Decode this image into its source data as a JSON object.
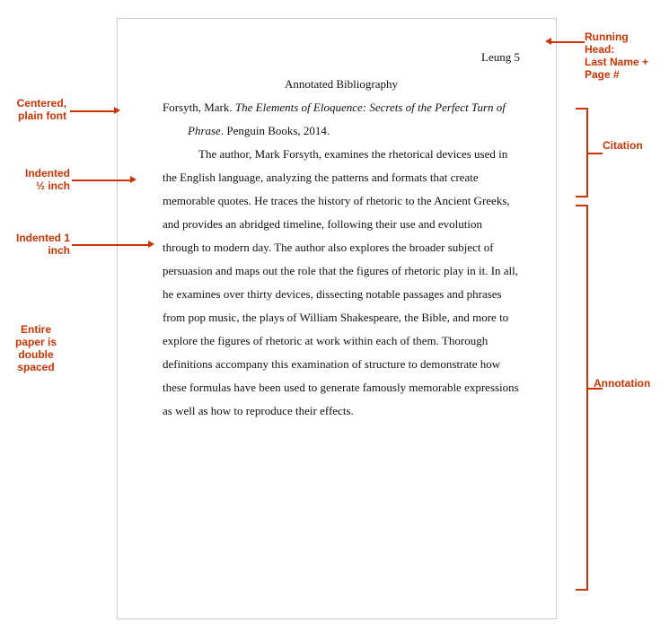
{
  "page": {
    "running_head": "Leung 5",
    "title": "Annotated Bibliography",
    "citation_line1": "Forsyth, Mark. ",
    "citation_italic": "The Elements of Eloquence: Secrets of the Perfect Turn of",
    "citation_italic2": "Phrase",
    "citation_end": ". Penguin Books, 2014.",
    "annotation": "The author, Mark Forsyth, examines the rhetorical devices used in the English language, analyzing the patterns and formats that create memorable quotes. He traces the history of rhetoric to the Ancient Greeks, and provides an abridged timeline, following their use and evolution through to modern day. The author also explores the broader subject of persuasion and maps out the role that the figures of rhetoric play in it. In all, he examines over thirty devices, dissecting notable passages and phrases from pop music, the plays of William Shakespeare, the Bible, and more to explore the figures of rhetoric at work within each of them. Thorough definitions accompany this examination of structure to demonstrate how these formulas have been used to generate famously memorable expressions as well as how to reproduce their effects."
  },
  "labels": {
    "centered": "Centered,\nplain font",
    "indented_half": "Indented\n½ inch",
    "indented_1": "Indented 1\ninch",
    "double_spaced": "Entire\npaper is\ndouble\nspaced",
    "running_head": "Running\nHead:\nLast Name +\nPage #",
    "citation": "Citation",
    "annotation": "Annotation"
  }
}
